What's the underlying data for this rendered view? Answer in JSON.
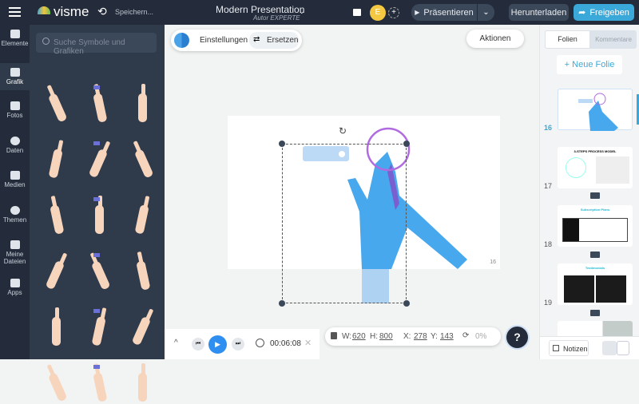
{
  "header": {
    "logo": "visme",
    "saving": "Speichern...",
    "title": "Modern Presentation",
    "subtitle": "Autor EXPERTE",
    "avatar": "E",
    "present": "Präsentieren",
    "download": "Herunterladen",
    "share": "Freigeben"
  },
  "rail": [
    {
      "label": "Elemente"
    },
    {
      "label": "Grafik"
    },
    {
      "label": "Fotos"
    },
    {
      "label": "Daten"
    },
    {
      "label": "Medien"
    },
    {
      "label": "Themen"
    },
    {
      "label": "Meine Dateien"
    },
    {
      "label": "Apps"
    }
  ],
  "panel": {
    "search_placeholder": "Suche Symbole und Grafiken"
  },
  "toolbar": {
    "settings": "Einstellungen",
    "replace": "Ersetzen",
    "actions": "Aktionen"
  },
  "slide": {
    "number": "16"
  },
  "bottom": {
    "time": "00:06:08",
    "w_label": "W:",
    "w": "620",
    "h_label": "H:",
    "h": "800",
    "x_label": "X:",
    "x": "278",
    "y_label": "Y:",
    "y": "143",
    "rotation": "0%",
    "help": "?"
  },
  "right": {
    "tab_slides": "Folien",
    "tab_comments": "Kommentare",
    "new_slide": "+ Neue Folie",
    "slides": [
      {
        "num": "16"
      },
      {
        "num": "17",
        "title": "3-STEPS PROCESS MODEL"
      },
      {
        "num": "18",
        "title": "Subscription Plans"
      },
      {
        "num": "19",
        "title": "Testimonials"
      }
    ],
    "notes": "Notizen"
  },
  "colors": {
    "accent": "#3aa8d8",
    "primary": "#2f8ff0",
    "topbar": "#242b3a"
  }
}
